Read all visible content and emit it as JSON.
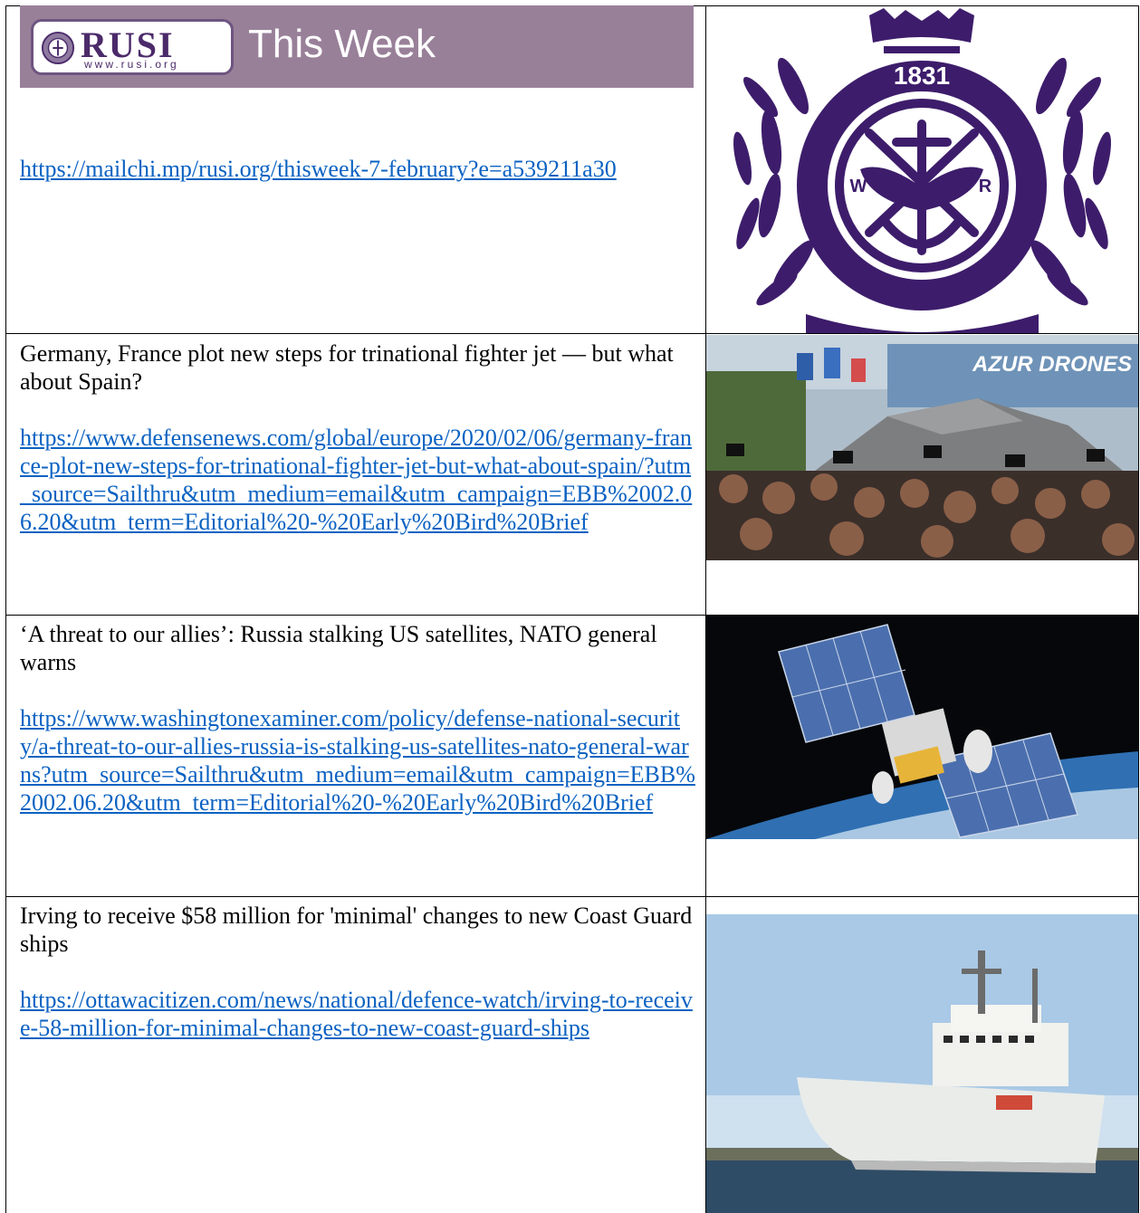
{
  "rows": [
    {
      "banner": {
        "logo_word": "RUSI",
        "logo_url": "www.rusi.org",
        "heading": "This Week"
      },
      "link": "https://mailchi.mp/rusi.org/thisweek-7-february?e=a539211a30",
      "image": {
        "kind": "rusi-crest",
        "year": "1831",
        "left_letter": "W",
        "right_letter": "R",
        "color": "#3d1d6b"
      }
    },
    {
      "title": "Germany, France plot new steps for trinational fighter jet — but what about Spain?",
      "link": "https://www.defensenews.com/global/europe/2020/02/06/germany-france-plot-new-steps-for-trinational-fighter-jet-but-what-about-spain/?utm_source=Sailthru&utm_medium=email&utm_campaign=EBB%2002.06.20&utm_term=Editorial%20-%20Early%20Bird%20Brief",
      "image": {
        "kind": "fighter-jet-photo",
        "sign_text": "AZUR DRONES"
      }
    },
    {
      "title": "‘A threat to our allies’: Russia stalking US satellites, NATO general warns",
      "link": "https://www.washingtonexaminer.com/policy/defense-national-security/a-threat-to-our-allies-russia-is-stalking-us-satellites-nato-general-warns?utm_source=Sailthru&utm_medium=email&utm_campaign=EBB%2002.06.20&utm_term=Editorial%20-%20Early%20Bird%20Brief",
      "image": {
        "kind": "satellite-photo"
      }
    },
    {
      "title": "Irving to receive $58 million for 'minimal' changes to new Coast Guard ships",
      "link": "https://ottawacitizen.com/news/national/defence-watch/irving-to-receive-58-million-for-minimal-changes-to-new-coast-guard-ships",
      "image": {
        "kind": "ship-photo"
      }
    }
  ]
}
